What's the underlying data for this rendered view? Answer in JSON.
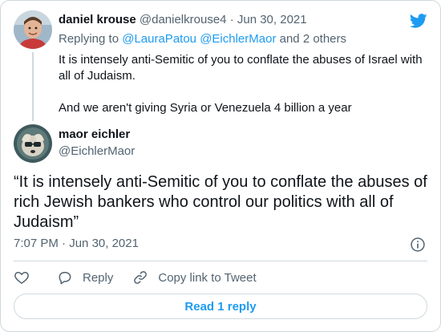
{
  "reply_tweet": {
    "author_name": "daniel krouse",
    "author_handle": "@danielkrouse4",
    "separator": "·",
    "date": "Jun 30, 2021",
    "replying_prefix": "Replying to",
    "replying_user1": "@LauraPatou",
    "replying_user2": "@EichlerMaor",
    "replying_suffix": "and 2 others",
    "text_line1": "It is intensely anti-Semitic of you to conflate the abuses of Israel with all of Judaism.",
    "text_line2": "And we aren't giving Syria or Venezuela 4 billion a year"
  },
  "main_tweet": {
    "author_name": "maor eichler",
    "author_handle": "@EichlerMaor",
    "text": "“It is intensely anti-Semitic of you to conflate the abuses of rich Jewish bankers who control our politics with all of Judaism”",
    "time": "7:07 PM",
    "separator": "·",
    "date": "Jun 30, 2021"
  },
  "actions": {
    "like_icon": "heart-icon",
    "reply_label": "Reply",
    "reply_icon": "speech-bubble-icon",
    "copy_link_label": "Copy link to Tweet",
    "copy_link_icon": "link-icon"
  },
  "read_replies_label": "Read 1 reply",
  "colors": {
    "accent": "#1d9bf0",
    "muted": "#536471",
    "text": "#0f1419",
    "border": "#cfd9de"
  }
}
